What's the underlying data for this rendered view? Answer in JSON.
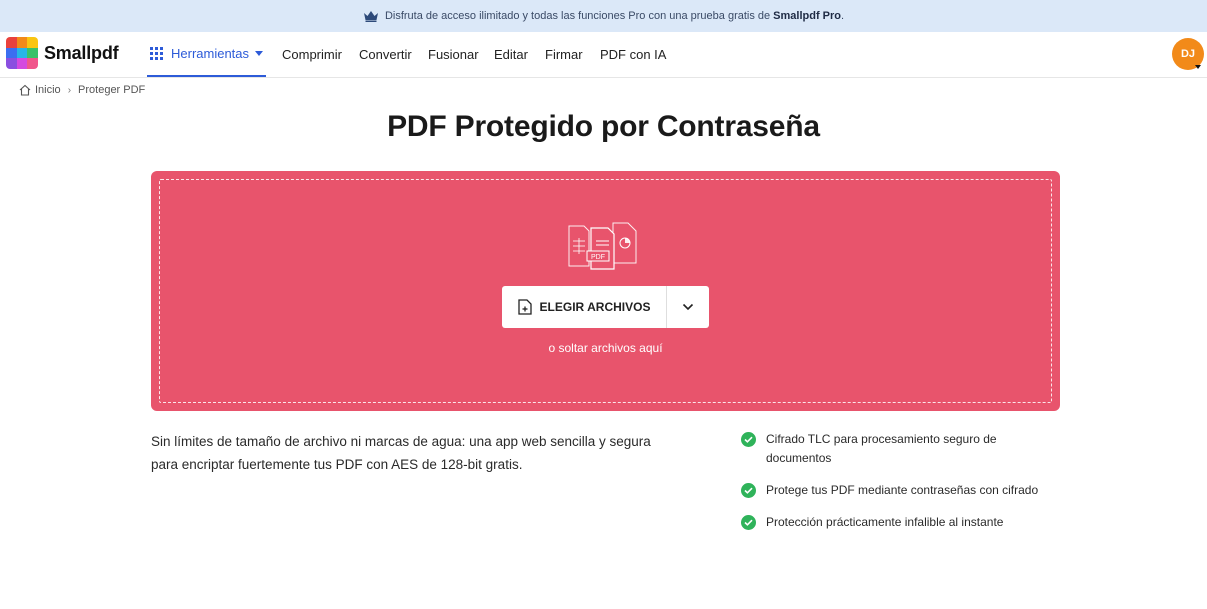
{
  "promo": {
    "text": "Disfruta de acceso ilimitado y todas las funciones Pro con una prueba gratis de",
    "brand": "Smallpdf Pro",
    "suffix": "."
  },
  "header": {
    "logo_text": "Smallpdf",
    "tools_label": "Herramientas",
    "nav": [
      "Comprimir",
      "Convertir",
      "Fusionar",
      "Editar",
      "Firmar",
      "PDF con IA"
    ],
    "avatar_initials": "DJ"
  },
  "breadcrumb": {
    "home": "Inicio",
    "current": "Proteger PDF"
  },
  "page_title": "PDF Protegido por Contraseña",
  "dropzone": {
    "button_label": "ELEGIR ARCHIVOS",
    "drop_hint": "o soltar archivos aquí",
    "illustration_label": "PDF",
    "bg_color": "#e8546c"
  },
  "description": "Sin límites de tamaño de archivo ni marcas de agua: una app web sencilla y segura para encriptar fuertemente tus PDF con AES de 128-bit gratis.",
  "features": [
    "Cifrado TLC para procesamiento seguro de documentos",
    "Protege tus PDF mediante contraseñas con cifrado",
    "Protección prácticamente infalible al instante"
  ],
  "colors": {
    "accent": "#2d5bd8",
    "check": "#2fb35a",
    "avatar": "#f28a19",
    "promo_bg": "#dbe8f8"
  }
}
